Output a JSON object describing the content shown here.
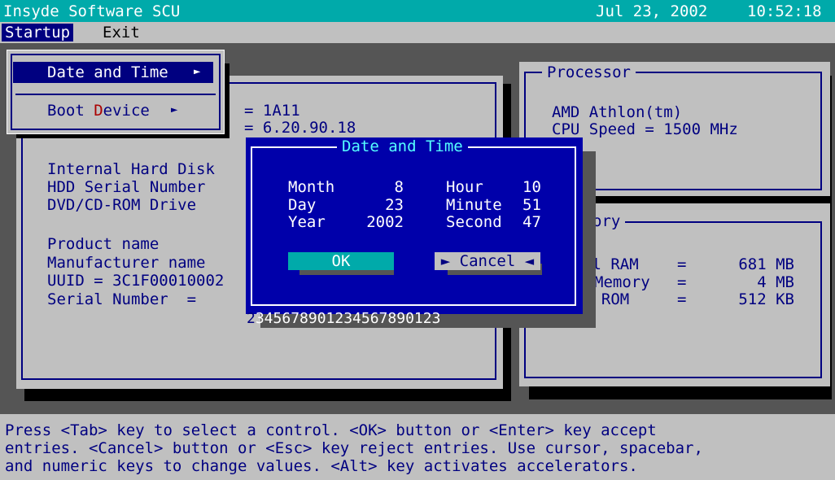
{
  "title": {
    "app": "Insyde Software SCU",
    "date": "Jul 23, 2002",
    "time": "10:52:18"
  },
  "menu": {
    "items": [
      "Startup",
      "Exit"
    ]
  },
  "startup_menu": {
    "items": [
      {
        "label": "Date and Time",
        "arrow": "►"
      },
      {
        "label_pre": "Boot ",
        "label_hot": "D",
        "label_post": "evice",
        "arrow": "►"
      }
    ]
  },
  "system_panel": {
    "bios_value_1": "= 1A11",
    "bios_value_2": "= 6.20.90.18",
    "internal_hdd": "Internal Hard Disk",
    "hdd_serial": "HDD Serial Number",
    "dvd": "DVD/CD-ROM Drive",
    "product_name": "Product name",
    "manufacturer": "Manufacturer name",
    "uuid": "UUID = 3C1F00010002",
    "serial_number": "Serial Number  =",
    "serial_value_hl": "2",
    "serial_value_rest": "345678901234567890123"
  },
  "processor_panel": {
    "title": "Processor",
    "cpu": "AMD Athlon(tm)",
    "speed": "CPU Speed = 1500 MHz"
  },
  "memory_panel": {
    "title": "ory",
    "rows": [
      {
        "label": "al RAM",
        "eq": "=",
        "value": "681 MB"
      },
      {
        "label": "Memory",
        "eq": "=",
        "value": "4 MB"
      },
      {
        "label": "S ROM",
        "eq": "=",
        "value": "512 KB"
      }
    ]
  },
  "dialog": {
    "title": "Date and Time",
    "month_label": "Month",
    "month_value": "8",
    "day_label": "Day",
    "day_value": "23",
    "year_label": "Year",
    "year_value": "2002",
    "hour_label": "Hour",
    "hour_value": "10",
    "minute_label": "Minute",
    "minute_value": "51",
    "second_label": "Second",
    "second_value": "47",
    "ok_label": "OK",
    "cancel_label": "► Cancel ◄"
  },
  "status": {
    "line1": "Press <Tab> key to select a control. <OK> button or <Enter> key accept",
    "line2": "entries. <Cancel> button or <Esc> key reject entries. Use cursor, spacebar,",
    "line3": "and numeric keys to change values. <Alt> key activates accelerators."
  },
  "colors": {
    "title_bg": "#00aaaa",
    "menu_bg": "#c0c0c0",
    "desktop": "#555555",
    "panel_bg": "#c0c0c0",
    "text": "#000080",
    "dialog_bg": "#0000aa",
    "button_bg": "#00aaaa",
    "highlight_text": "#ffffff",
    "hotkey": "#aa0000"
  }
}
